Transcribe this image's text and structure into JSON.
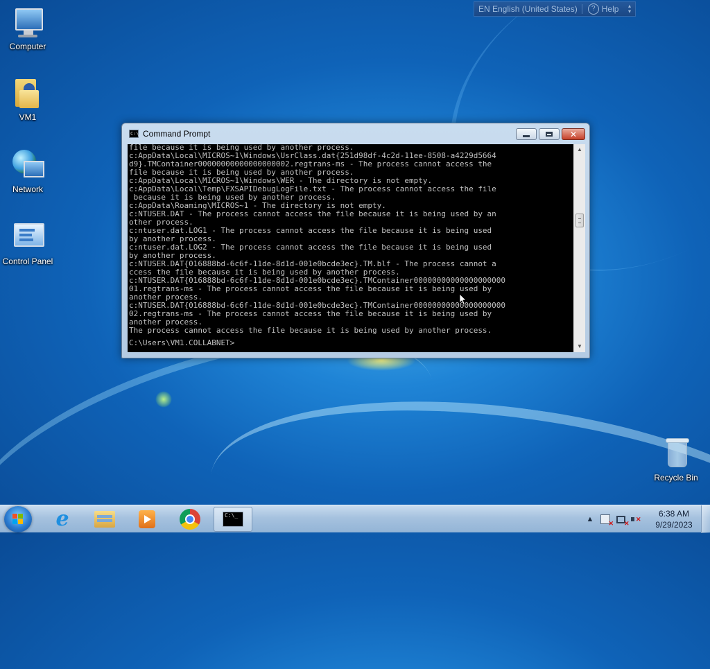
{
  "desktop": {
    "icons": [
      {
        "label": "Computer"
      },
      {
        "label": "VM1"
      },
      {
        "label": "Network"
      },
      {
        "label": "Control Panel"
      },
      {
        "label": "Recycle Bin"
      }
    ]
  },
  "language_bar": {
    "language": "EN English (United States)",
    "help_label": "Help"
  },
  "cmd_window": {
    "title": "Command Prompt",
    "lines": [
      "file because it is being used by another process.",
      "c:AppData\\Local\\MICROS~1\\Windows\\UsrClass.dat{251d98df-4c2d-11ee-8508-a4229d5664",
      "d9}.TMContainer00000000000000000002.regtrans-ms - The process cannot access the",
      "file because it is being used by another process.",
      "c:AppData\\Local\\MICROS~1\\Windows\\WER - The directory is not empty.",
      "c:AppData\\Local\\Temp\\FXSAPIDebugLogFile.txt - The process cannot access the file",
      " because it is being used by another process.",
      "c:AppData\\Roaming\\MICROS~1 - The directory is not empty.",
      "c:NTUSER.DAT - The process cannot access the file because it is being used by an",
      "other process.",
      "c:ntuser.dat.LOG1 - The process cannot access the file because it is being used",
      "by another process.",
      "c:ntuser.dat.LOG2 - The process cannot access the file because it is being used",
      "by another process.",
      "c:NTUSER.DAT{016888bd-6c6f-11de-8d1d-001e0bcde3ec}.TM.blf - The process cannot a",
      "ccess the file because it is being used by another process.",
      "c:NTUSER.DAT{016888bd-6c6f-11de-8d1d-001e0bcde3ec}.TMContainer00000000000000000000",
      "01.regtrans-ms - The process cannot access the file because it is being used by",
      "another process.",
      "c:NTUSER.DAT{016888bd-6c6f-11de-8d1d-001e0bcde3ec}.TMContainer00000000000000000000",
      "02.regtrans-ms - The process cannot access the file because it is being used by",
      "another process.",
      "The process cannot access the file because it is being used by another process."
    ],
    "prompt": "C:\\Users\\VM1.COLLABNET>"
  },
  "taskbar": {
    "pinned": [
      {
        "icon": "internet-explorer-icon"
      },
      {
        "icon": "windows-explorer-icon"
      },
      {
        "icon": "media-player-icon"
      },
      {
        "icon": "chrome-icon"
      },
      {
        "icon": "command-prompt-icon"
      }
    ],
    "clock": {
      "time": "6:38 AM",
      "date": "9/29/2023"
    }
  },
  "colors": {
    "console_bg": "#000000",
    "console_text": "#c0c0c0",
    "close_button": "#c7412a"
  }
}
